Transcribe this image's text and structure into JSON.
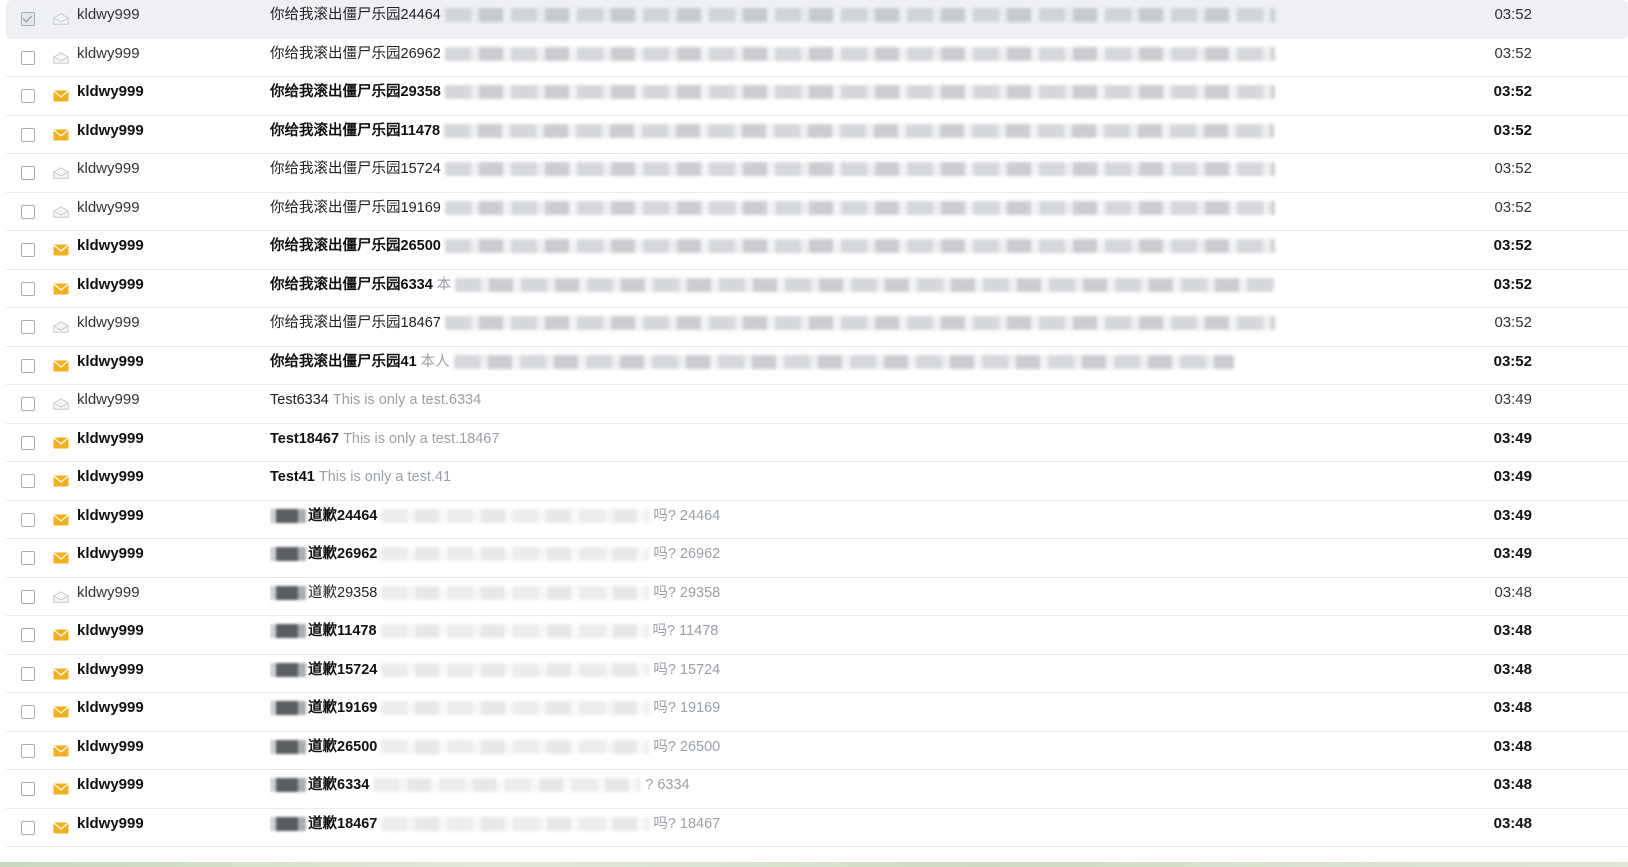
{
  "colors": {
    "unread_envelope": "#f2b01e",
    "read_envelope": "#c4c8cd",
    "preview_text": "#9aa0a6"
  },
  "icons": {
    "unread": "envelope-closed-icon",
    "read": "envelope-open-icon"
  },
  "emails": [
    {
      "sender": "kldwy999",
      "subject": "你给我滚出僵尸乐园24464",
      "preview": "",
      "time": "03:52",
      "unread": false,
      "selected": true,
      "blur": "bar"
    },
    {
      "sender": "kldwy999",
      "subject": "你给我滚出僵尸乐园26962",
      "preview": "",
      "time": "03:52",
      "unread": false,
      "selected": false,
      "blur": "bar"
    },
    {
      "sender": "kldwy999",
      "subject": "你给我滚出僵尸乐园29358",
      "preview": "",
      "time": "03:52",
      "unread": true,
      "selected": false,
      "blur": "bar"
    },
    {
      "sender": "kldwy999",
      "subject": "你给我滚出僵尸乐园11478",
      "preview": "",
      "time": "03:52",
      "unread": true,
      "selected": false,
      "blur": "bar"
    },
    {
      "sender": "kldwy999",
      "subject": "你给我滚出僵尸乐园15724",
      "preview": "",
      "time": "03:52",
      "unread": false,
      "selected": false,
      "blur": "bar"
    },
    {
      "sender": "kldwy999",
      "subject": "你给我滚出僵尸乐园19169",
      "preview": "",
      "time": "03:52",
      "unread": false,
      "selected": false,
      "blur": "bar"
    },
    {
      "sender": "kldwy999",
      "subject": "你给我滚出僵尸乐园26500",
      "preview": "",
      "time": "03:52",
      "unread": true,
      "selected": false,
      "blur": "bar"
    },
    {
      "sender": "kldwy999",
      "subject": "你给我滚出僵尸乐园6334",
      "preview": "本",
      "time": "03:52",
      "unread": true,
      "selected": false,
      "blur": "bar"
    },
    {
      "sender": "kldwy999",
      "subject": "你给我滚出僵尸乐园18467",
      "preview": "",
      "time": "03:52",
      "unread": false,
      "selected": false,
      "blur": "bar"
    },
    {
      "sender": "kldwy999",
      "subject": "你给我滚出僵尸乐园41",
      "preview": "本人",
      "time": "03:52",
      "unread": true,
      "selected": false,
      "blur": "bar"
    },
    {
      "sender": "kldwy999",
      "subject": "Test6334",
      "preview": "This is only a test.6334",
      "time": "03:49",
      "unread": false,
      "selected": false,
      "blur": "none"
    },
    {
      "sender": "kldwy999",
      "subject": "Test18467",
      "preview": "This is only a test.18467",
      "time": "03:49",
      "unread": true,
      "selected": false,
      "blur": "none"
    },
    {
      "sender": "kldwy999",
      "subject": "Test41",
      "preview": "This is only a test.41",
      "time": "03:49",
      "unread": true,
      "selected": false,
      "blur": "none"
    },
    {
      "sender": "kldwy999",
      "subject": "道歉24464",
      "preview": "吗? 24464",
      "time": "03:49",
      "unread": true,
      "selected": false,
      "blur": "apology"
    },
    {
      "sender": "kldwy999",
      "subject": "道歉26962",
      "preview": "吗? 26962",
      "time": "03:49",
      "unread": true,
      "selected": false,
      "blur": "apology"
    },
    {
      "sender": "kldwy999",
      "subject": "道歉29358",
      "preview": "吗? 29358",
      "time": "03:48",
      "unread": false,
      "selected": false,
      "blur": "apology"
    },
    {
      "sender": "kldwy999",
      "subject": "道歉11478",
      "preview": "吗? 11478",
      "time": "03:48",
      "unread": true,
      "selected": false,
      "blur": "apology"
    },
    {
      "sender": "kldwy999",
      "subject": "道歉15724",
      "preview": "吗? 15724",
      "time": "03:48",
      "unread": true,
      "selected": false,
      "blur": "apology"
    },
    {
      "sender": "kldwy999",
      "subject": "道歉19169",
      "preview": "吗? 19169",
      "time": "03:48",
      "unread": true,
      "selected": false,
      "blur": "apology"
    },
    {
      "sender": "kldwy999",
      "subject": "道歉26500",
      "preview": "吗? 26500",
      "time": "03:48",
      "unread": true,
      "selected": false,
      "blur": "apology"
    },
    {
      "sender": "kldwy999",
      "subject": "道歉6334",
      "preview": "? 6334",
      "time": "03:48",
      "unread": true,
      "selected": false,
      "blur": "apology"
    },
    {
      "sender": "kldwy999",
      "subject": "道歉18467",
      "preview": "吗? 18467",
      "time": "03:48",
      "unread": true,
      "selected": false,
      "blur": "apology"
    }
  ]
}
